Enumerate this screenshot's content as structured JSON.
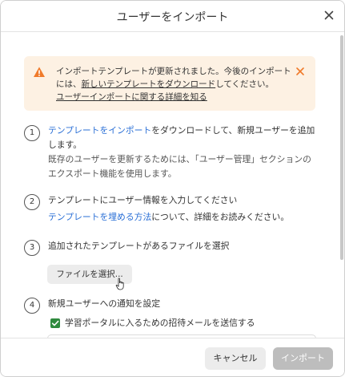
{
  "dialog": {
    "title": "ユーザーをインポート",
    "close_icon": "close-icon"
  },
  "alert": {
    "icon": "warning-icon",
    "text_1": "インポートテンプレートが更新されました。今後のインポートには、",
    "link_new_template": "新しいテンプレートをダウンロード",
    "text_2": "してください。",
    "link_details": "ユーザーインポートに関する詳細を知る",
    "close_icon": "close-icon",
    "accent_color": "#f07a2a",
    "background": "#fdf1e3"
  },
  "steps": [
    {
      "number": "1",
      "link": "テンプレートをインポート",
      "text": "をダウンロードして、新規ユーザーを追加します。",
      "sub": "既存のユーザーを更新するためには、「ユーザー管理」セクションのエクスポート機能を使用します。"
    },
    {
      "number": "2",
      "text": "テンプレートにユーザー情報を入力してください",
      "link": "テンプレートを埋める方法",
      "text_after": "について、詳細をお読みください。"
    },
    {
      "number": "3",
      "text": "追加されたテンプレートがあるファイルを選択",
      "button": "ファイルを選択..."
    },
    {
      "number": "4",
      "text": "新規ユーザーへの通知を設定",
      "checkbox_label": "学習ポータルに入るための招待メールを送信する",
      "checkbox_checked": true
    }
  ],
  "footer": {
    "cancel": "キャンセル",
    "import": "インポート"
  },
  "colors": {
    "link": "#2a6fd6",
    "checkbox": "#2f8a3e",
    "import_disabled": "#bdbdbd"
  }
}
